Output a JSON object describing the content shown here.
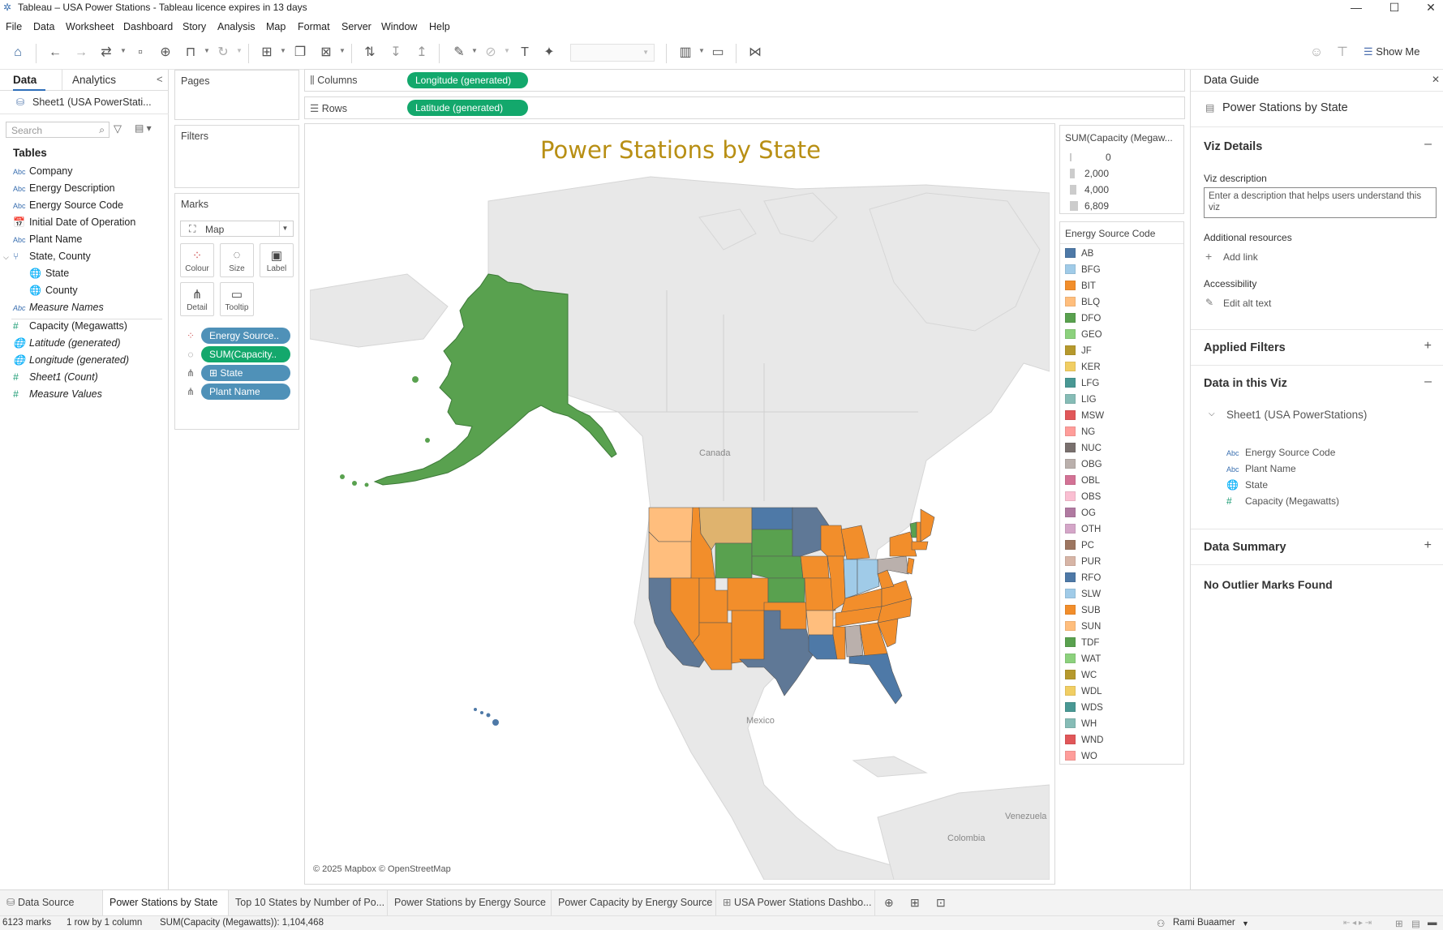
{
  "window": {
    "title": "Tableau – USA Power Stations - Tableau licence expires in 13 days",
    "minimize": "—",
    "maximize": "☐",
    "close": "✕"
  },
  "menu": [
    "File",
    "Data",
    "Worksheet",
    "Dashboard",
    "Story",
    "Analysis",
    "Map",
    "Format",
    "Server",
    "Window",
    "Help"
  ],
  "toolbar": {
    "show_me": "Show Me",
    "icons": [
      "home-icon",
      "undo-icon",
      "redo-icon",
      "replay-icon",
      "save-icon",
      "new-datasource-icon",
      "pause-icon",
      "refresh-icon",
      "new-sheet-icon",
      "duplicate-icon",
      "clear-icon",
      "swap-icon",
      "sort-asc-icon",
      "sort-desc-icon",
      "highlight-icon",
      "group-icon",
      "text-label-icon",
      "pin-icon",
      "fit-icon",
      "presentation-icon",
      "share-icon"
    ]
  },
  "left": {
    "tab_data": "Data",
    "tab_analytics": "Analytics",
    "collapse": "<",
    "datasource": "Sheet1 (USA PowerStati...",
    "search_placeholder": "Search",
    "tables_heading": "Tables",
    "fields": [
      {
        "icon": "Abc",
        "label": "Company"
      },
      {
        "icon": "Abc",
        "label": "Energy Description"
      },
      {
        "icon": "Abc",
        "label": "Energy Source Code"
      },
      {
        "icon": "📅",
        "label": "Initial Date of Operation"
      },
      {
        "icon": "Abc",
        "label": "Plant Name"
      },
      {
        "icon": "⑂",
        "label": "State, County"
      },
      {
        "icon": "🌐",
        "label": "State"
      },
      {
        "icon": "🌐",
        "label": "County"
      },
      {
        "icon": "Abc",
        "label": "Measure Names"
      },
      {
        "icon": "#",
        "label": "Capacity (Megawatts)"
      },
      {
        "icon": "🌐",
        "label": "Latitude (generated)"
      },
      {
        "icon": "🌐",
        "label": "Longitude (generated)"
      },
      {
        "icon": "#",
        "label": "Sheet1 (Count)"
      },
      {
        "icon": "#",
        "label": "Measure Values"
      }
    ]
  },
  "shelves": {
    "pages": "Pages",
    "filters": "Filters",
    "marks": "Marks",
    "mark_type": "Map",
    "buttons": [
      "Colour",
      "Size",
      "Label",
      "Detail",
      "Tooltip"
    ],
    "mark_pills": [
      "Energy Source..",
      "SUM(Capacity..",
      "⊞  State",
      "Plant Name"
    ],
    "columns_label": "Columns",
    "rows_label": "Rows",
    "columns_pill": "Longitude (generated)",
    "rows_pill": "Latitude (generated)"
  },
  "viz": {
    "title": "Power Stations by State",
    "labels": {
      "canada": "Canada",
      "mexico": "Mexico",
      "venezuela": "Venezuela",
      "colombia": "Colombia"
    },
    "attribution": "© 2025 Mapbox © OpenStreetMap"
  },
  "size_legend": {
    "title": "SUM(Capacity (Megaw...",
    "entries": [
      "0",
      "2,000",
      "4,000",
      "6,809"
    ]
  },
  "color_legend": {
    "title": "Energy Source Code",
    "entries": [
      {
        "code": "AB",
        "color": "#4e79a7"
      },
      {
        "code": "BFG",
        "color": "#a0cbe8"
      },
      {
        "code": "BIT",
        "color": "#f28e2b"
      },
      {
        "code": "BLQ",
        "color": "#ffbe7d"
      },
      {
        "code": "DFO",
        "color": "#59a14f"
      },
      {
        "code": "GEO",
        "color": "#8cd17d"
      },
      {
        "code": "JF",
        "color": "#b6992d"
      },
      {
        "code": "KER",
        "color": "#f1ce63"
      },
      {
        "code": "LFG",
        "color": "#499894"
      },
      {
        "code": "LIG",
        "color": "#86bcb6"
      },
      {
        "code": "MSW",
        "color": "#e15759"
      },
      {
        "code": "NG",
        "color": "#ff9d9a"
      },
      {
        "code": "NUC",
        "color": "#79706e"
      },
      {
        "code": "OBG",
        "color": "#bab0ac"
      },
      {
        "code": "OBL",
        "color": "#d37295"
      },
      {
        "code": "OBS",
        "color": "#fabfd2"
      },
      {
        "code": "OG",
        "color": "#b07aa1"
      },
      {
        "code": "OTH",
        "color": "#d4a6c8"
      },
      {
        "code": "PC",
        "color": "#9d7660"
      },
      {
        "code": "PUR",
        "color": "#d7b5a6"
      },
      {
        "code": "RFO",
        "color": "#4e79a7"
      },
      {
        "code": "SLW",
        "color": "#a0cbe8"
      },
      {
        "code": "SUB",
        "color": "#f28e2b"
      },
      {
        "code": "SUN",
        "color": "#ffbe7d"
      },
      {
        "code": "TDF",
        "color": "#59a14f"
      },
      {
        "code": "WAT",
        "color": "#8cd17d"
      },
      {
        "code": "WC",
        "color": "#b6992d"
      },
      {
        "code": "WDL",
        "color": "#f1ce63"
      },
      {
        "code": "WDS",
        "color": "#499894"
      },
      {
        "code": "WH",
        "color": "#86bcb6"
      },
      {
        "code": "WND",
        "color": "#e15759"
      },
      {
        "code": "WO",
        "color": "#ff9d9a"
      }
    ]
  },
  "guide": {
    "title": "Data Guide",
    "close": "✕",
    "sheet_title": "Power Stations by State",
    "viz_details": "Viz Details",
    "viz_description_label": "Viz description",
    "viz_description_placeholder": "Enter a description that helps users understand this viz",
    "additional_resources": "Additional resources",
    "add_link": "Add link",
    "accessibility": "Accessibility",
    "edit_alt_text": "Edit alt text",
    "applied_filters": "Applied Filters",
    "data_in_viz": "Data in this Viz",
    "datasource": "Sheet1 (USA PowerStations)",
    "fields": [
      {
        "icon": "Abc",
        "label": "Energy Source Code"
      },
      {
        "icon": "Abc",
        "label": "Plant Name"
      },
      {
        "icon": "🌐",
        "label": "State"
      },
      {
        "icon": "#",
        "label": "Capacity (Megawatts)"
      }
    ],
    "data_summary": "Data Summary",
    "no_outliers": "No Outlier Marks Found"
  },
  "sheet_tabs": [
    "Data Source",
    "Power Stations by State",
    "Top 10 States by Number of Po...",
    "Power Stations by Energy Source",
    "Power Capacity by Energy Source",
    "USA Power Stations Dashbo..."
  ],
  "active_tab": "Power Stations by State",
  "status": {
    "marks": "6123 marks",
    "rows_cols": "1 row by 1 column",
    "sum": "SUM(Capacity (Megawatts)): 1,104,468",
    "user": "Rami Buaamer"
  }
}
